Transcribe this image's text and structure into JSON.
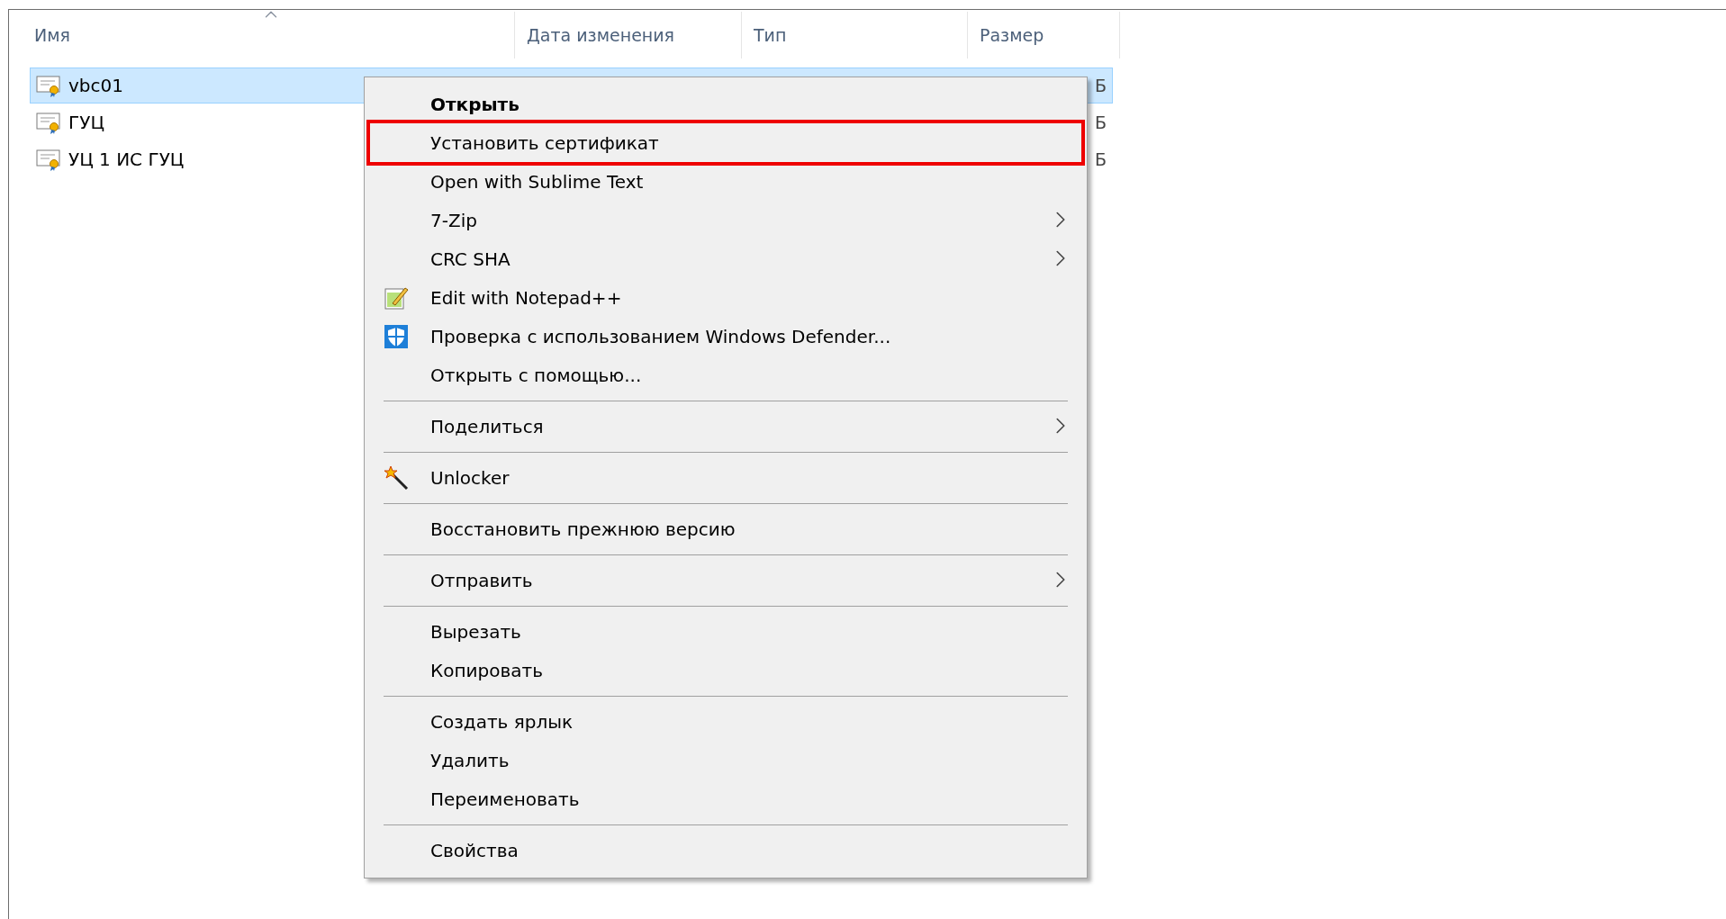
{
  "columns": [
    {
      "label": "Имя",
      "sorted": true
    },
    {
      "label": "Дата изменения",
      "sorted": false
    },
    {
      "label": "Тип",
      "sorted": false
    },
    {
      "label": "Размер",
      "sorted": false
    }
  ],
  "files": [
    {
      "name": "vbc01",
      "size": "Б",
      "selected": true
    },
    {
      "name": "ГУЦ",
      "size": "Б",
      "selected": false
    },
    {
      "name": "УЦ 1 ИС ГУЦ",
      "size": "Б",
      "selected": false
    }
  ],
  "context_menu": {
    "groups": [
      [
        {
          "label": "Открыть",
          "bold": true,
          "kind": "plain",
          "submenu": false,
          "outlined": false
        },
        {
          "label": "Установить сертификат",
          "bold": false,
          "kind": "plain",
          "submenu": false,
          "outlined": true
        },
        {
          "label": "Open with Sublime Text",
          "bold": false,
          "kind": "plain",
          "submenu": false,
          "outlined": false
        },
        {
          "label": "7-Zip",
          "bold": false,
          "kind": "plain",
          "submenu": true,
          "outlined": false
        },
        {
          "label": "CRC SHA",
          "bold": false,
          "kind": "plain",
          "submenu": true,
          "outlined": false
        },
        {
          "label": "Edit with Notepad++",
          "bold": false,
          "kind": "notepad",
          "submenu": false,
          "outlined": false
        },
        {
          "label": "Проверка с использованием Windows Defender...",
          "bold": false,
          "kind": "shield",
          "submenu": false,
          "outlined": false
        },
        {
          "label": "Открыть с помощью...",
          "bold": false,
          "kind": "plain",
          "submenu": false,
          "outlined": false
        }
      ],
      [
        {
          "label": "Поделиться",
          "bold": false,
          "kind": "plain",
          "submenu": true,
          "outlined": false
        }
      ],
      [
        {
          "label": "Unlocker",
          "bold": false,
          "kind": "wand",
          "submenu": false,
          "outlined": false
        }
      ],
      [
        {
          "label": "Восстановить прежнюю версию",
          "bold": false,
          "kind": "plain",
          "submenu": false,
          "outlined": false
        }
      ],
      [
        {
          "label": "Отправить",
          "bold": false,
          "kind": "plain",
          "submenu": true,
          "outlined": false
        }
      ],
      [
        {
          "label": "Вырезать",
          "bold": false,
          "kind": "plain",
          "submenu": false,
          "outlined": false
        },
        {
          "label": "Копировать",
          "bold": false,
          "kind": "plain",
          "submenu": false,
          "outlined": false
        }
      ],
      [
        {
          "label": "Создать ярлык",
          "bold": false,
          "kind": "plain",
          "submenu": false,
          "outlined": false
        },
        {
          "label": "Удалить",
          "bold": false,
          "kind": "plain",
          "submenu": false,
          "outlined": false
        },
        {
          "label": "Переименовать",
          "bold": false,
          "kind": "plain",
          "submenu": false,
          "outlined": false
        }
      ],
      [
        {
          "label": "Свойства",
          "bold": false,
          "kind": "plain",
          "submenu": false,
          "outlined": false
        }
      ]
    ]
  }
}
